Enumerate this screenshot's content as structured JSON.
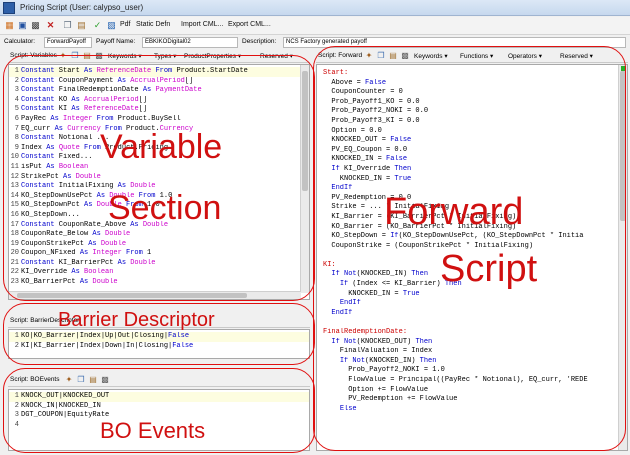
{
  "window": {
    "title": "Pricing Script (User: calypso_user)"
  },
  "toolbar": {
    "pdf_label": "Pdf",
    "static_defn_label": "Static Defn",
    "import_label": "Import CML...",
    "export_label": "Export CML..."
  },
  "info": {
    "calculator_label": "Calculator:",
    "calculator_value": "ForwardPayoff",
    "payoff_name_label": "Payoff Name:",
    "payoff_name_value": "EBKIKODigital02",
    "description_label": "Description:",
    "description_value": "NCS Factory generated payoff"
  },
  "variables_pane": {
    "title": "Script: Variables",
    "menus": [
      "Keywords",
      "Types",
      "ProductProperties",
      "Reserved"
    ],
    "lines": [
      "Constant Start As ReferenceDate From Product.StartDate",
      "Constant CouponPayment As AccrualPeriod[]",
      "Constant FinalRedemptionDate As PaymentDate",
      "Constant KO As AccrualPeriod[]",
      "Constant KI As ReferenceDate[]",
      "PayRec As Integer From Product.BuySell",
      "EQ_curr As Currency From Product.Currency",
      "Constant Notional ...",
      "Index As Quote From Product.Pricing",
      "Constant Fixed...",
      "isPut As Boolean",
      "StrikePct As Double",
      "Constant InitialFixing As Double",
      "KO_StepDownUsePct As Double From 1.0",
      "KO_StepDownPct As Double From 1.0",
      "KO_StepDown...",
      "Constant CouponRate_Above As Double",
      "CouponRate_Below As Double",
      "CouponStrikePct As Double",
      "Coupon_NFixed As Integer From 1",
      "Constant KI_BarrierPct As Double",
      "KI_Override As Boolean",
      "KO_BarrierPct As Double"
    ]
  },
  "barrier_pane": {
    "title": "Script: BarrierDescriptor",
    "lines": [
      "KO|KO_Barrier|Index|Up|Out|Closing|False",
      "KI|KI_Barrier|Index|Down|In|Closing|False"
    ]
  },
  "events_pane": {
    "title": "Script: BOEvents",
    "lines": [
      "KNOCK_OUT|KNOCKED_OUT",
      "KNOCK_IN|KNOCKED_IN",
      "DGT_COUPON|EquityRate",
      ""
    ]
  },
  "forward_pane": {
    "title": "Script: Forward",
    "menus": [
      "Keywords",
      "Functions",
      "Operators",
      "Reserved"
    ],
    "lines": [
      "Start:",
      "  Above = False",
      "  CouponCounter = 0",
      "  Prob_Payoff1_KO = 0.0",
      "  Prob_Payoff2_NOKI = 0.0",
      "  Prob_Payoff3_KI = 0.0",
      "  Option = 0.0",
      "  KNOCKED_OUT = False",
      "  PV_EQ_Coupon = 0.0",
      "  KNOCKED_IN = False",
      "  If KI_Override Then",
      "    KNOCKED_IN = True",
      "  EndIf",
      "  PV_Redemption = 0.0",
      "  Strike = ... * InitialFixing",
      "  KI_Barrier = (KI_BarrierPct * InitialFixing)",
      "  KO_Barrier = (KO_BarrierPct * InitialFixing)",
      "  KO_StepDown = If(KO_StepDownUsePct, (KO_StepDownPct * Initia",
      "  CouponStrike = (CouponStrikePct * InitialFixing)",
      "",
      "KI:",
      "  If Not(KNOCKED_IN) Then",
      "    If (Index <= KI_Barrier) Then",
      "      KNOCKED_IN = True",
      "    EndIf",
      "  EndIf",
      "",
      "FinalRedemptionDate:",
      "  If Not(KNOCKED_OUT) Then",
      "    FinalValuation = Index",
      "    If Not(KNOCKED_IN) Then",
      "      Prob_Payoff2_NOKI = 1.0",
      "      FlowValue = Principal((PayRec * Notional), EQ_curr, 'REDE",
      "      Option += FlowValue",
      "      PV_Redemption += FlowValue",
      "    Else"
    ]
  },
  "annotations": {
    "variable_section": [
      "Variable",
      "Section"
    ],
    "forward_script": [
      "Forward",
      "Script"
    ],
    "barrier_descriptor": "Barrier Descriptor",
    "bo_events": "BO Events"
  },
  "colors": {
    "annotation_red": "#e01010",
    "keyword_blue": "#0000cc",
    "type_magenta": "#cc00cc"
  }
}
